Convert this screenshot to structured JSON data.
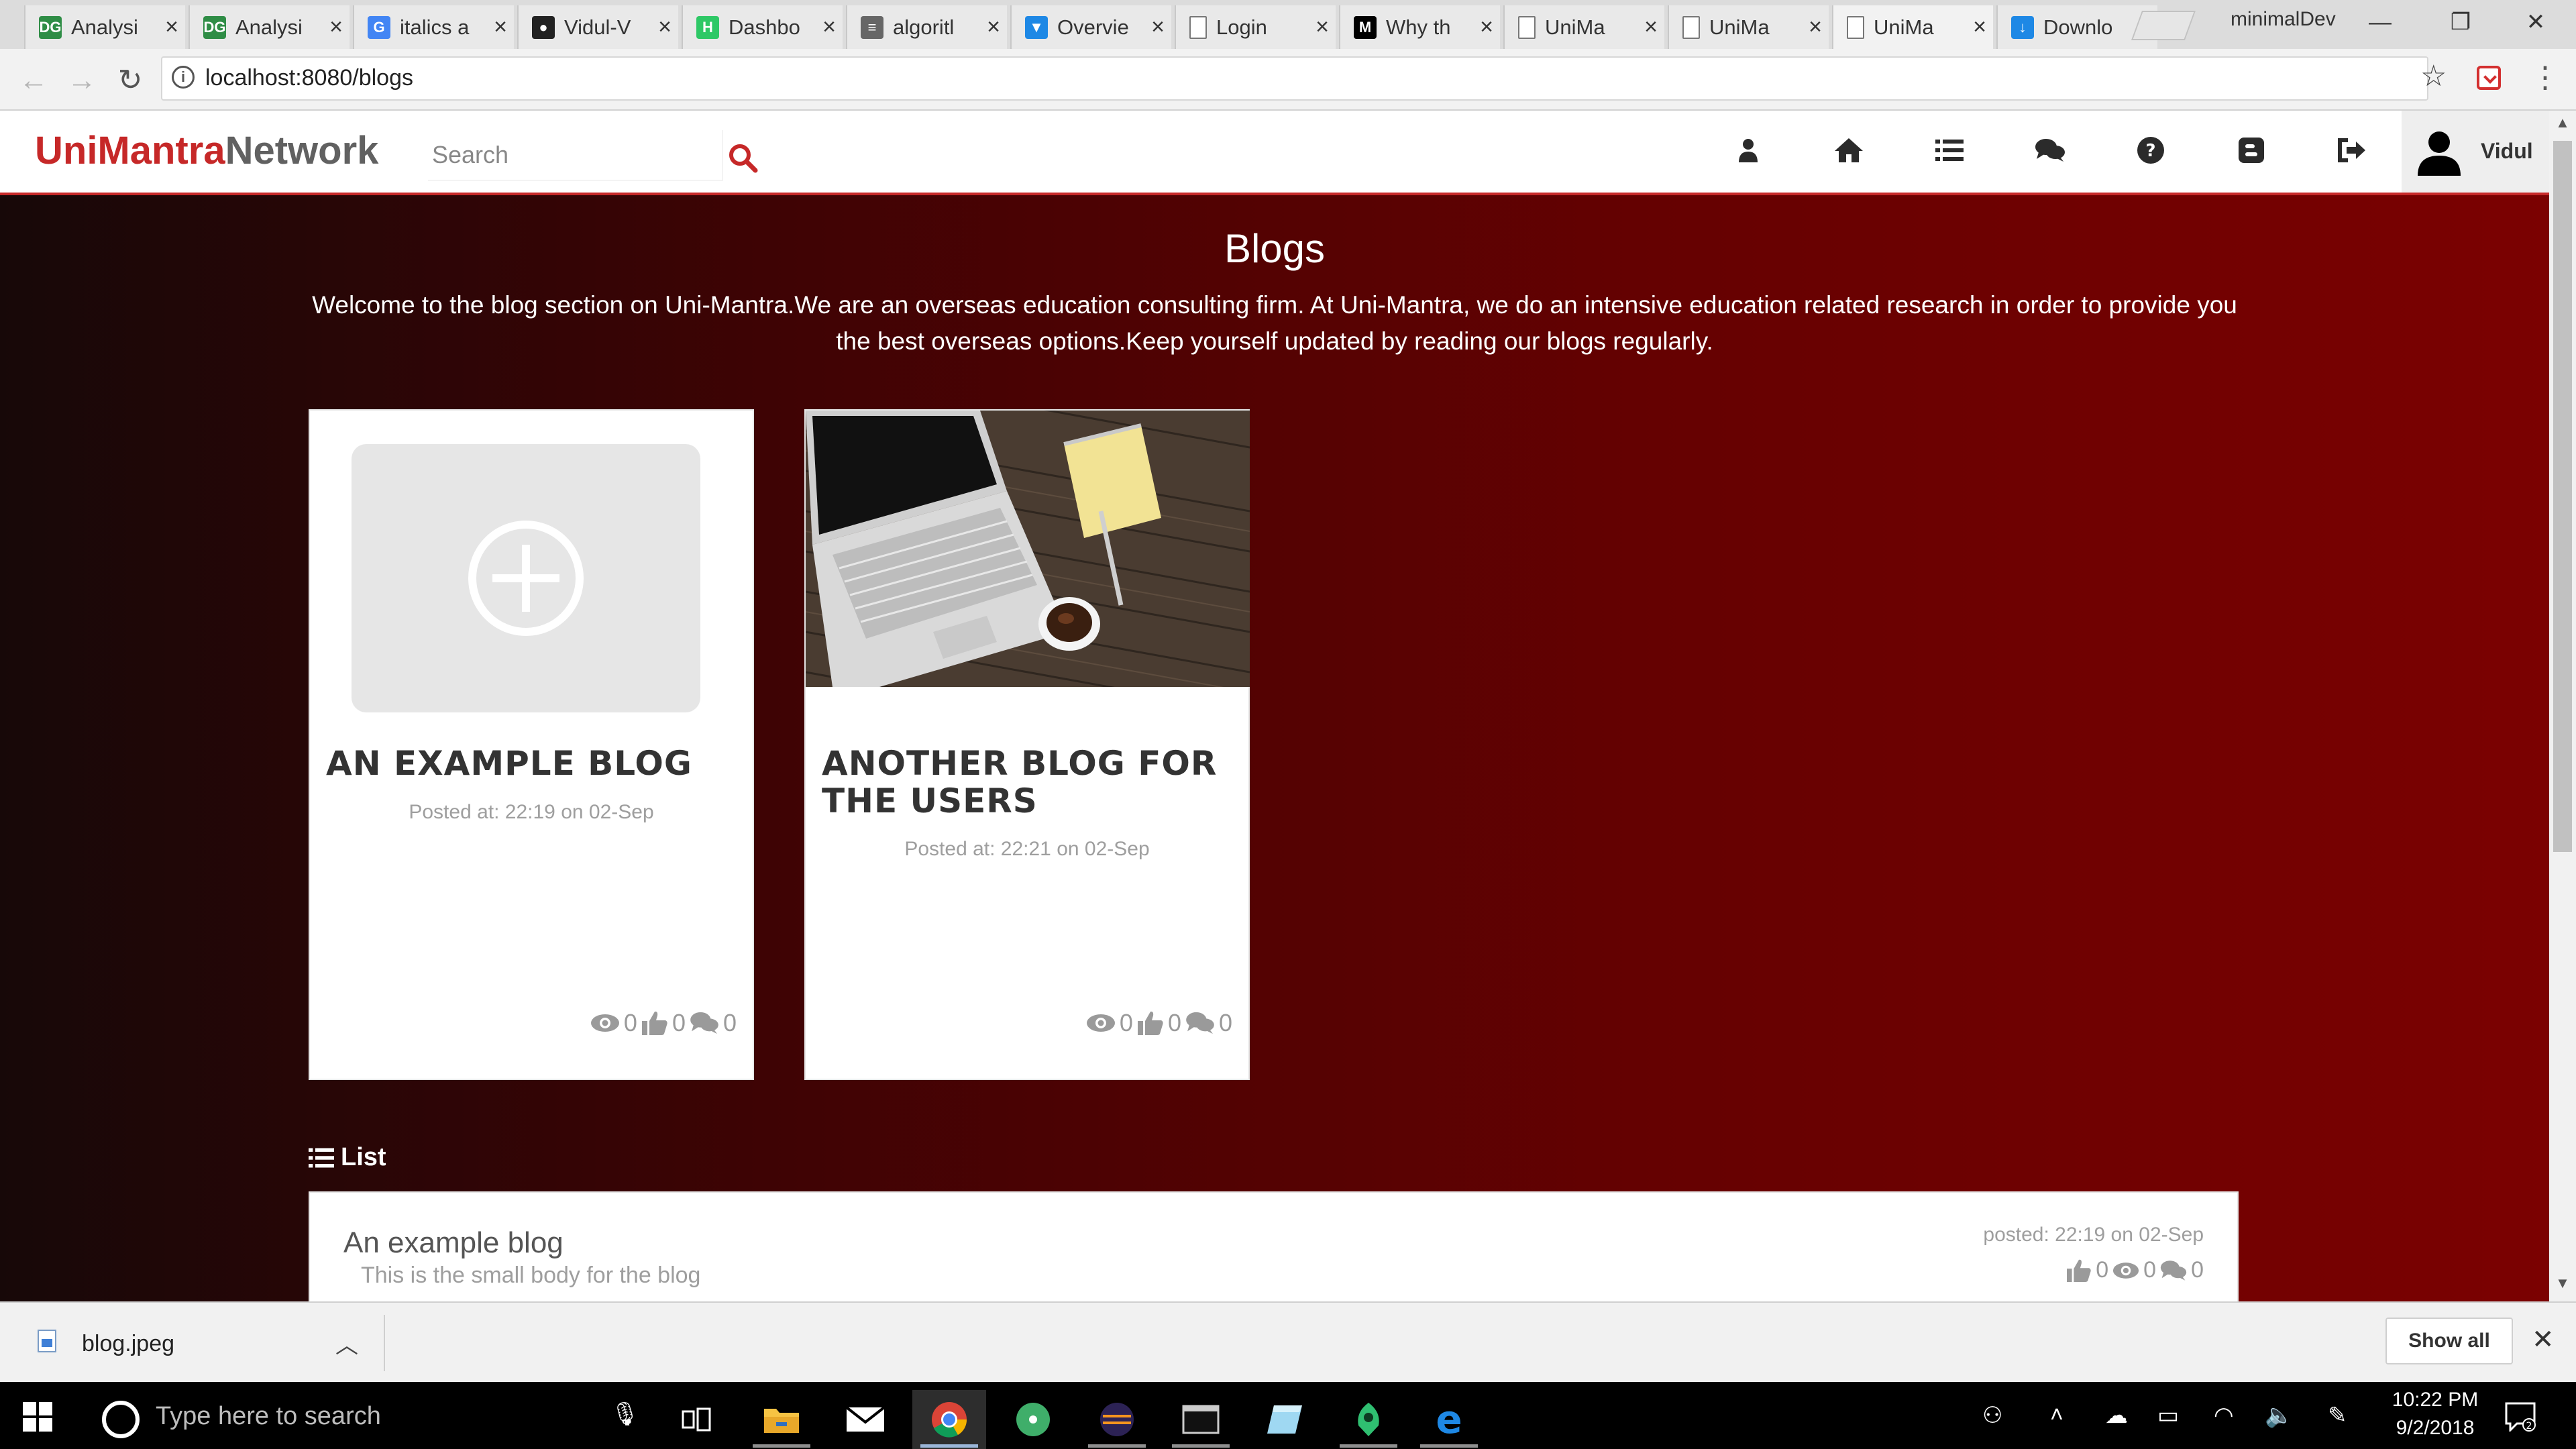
{
  "browser": {
    "tabs": [
      {
        "title": "Analysi",
        "favicon": "gfg-icon",
        "color": "#2f8d46",
        "glyph": "DG"
      },
      {
        "title": "Analysi",
        "favicon": "gfg-icon",
        "color": "#2f8d46",
        "glyph": "DG"
      },
      {
        "title": "italics a",
        "favicon": "google-icon",
        "color": "#4285f4",
        "glyph": "G"
      },
      {
        "title": "Vidul-V",
        "favicon": "github-icon",
        "color": "#222222",
        "glyph": "●"
      },
      {
        "title": "Dashbo",
        "favicon": "hackerearth-icon",
        "color": "#2ec866",
        "glyph": "H"
      },
      {
        "title": "algoritl",
        "favicon": "stackexchange-icon",
        "color": "#666666",
        "glyph": "≡"
      },
      {
        "title": "Overvie",
        "favicon": "shield-icon",
        "color": "#1e88e5",
        "glyph": "▼"
      },
      {
        "title": "Login",
        "favicon": "page-icon",
        "color": "#ffffff",
        "glyph": ""
      },
      {
        "title": "Why th",
        "favicon": "medium-icon",
        "color": "#000000",
        "glyph": "M"
      },
      {
        "title": "UniMa",
        "favicon": "page-icon",
        "color": "#ffffff",
        "glyph": ""
      },
      {
        "title": "UniMa",
        "favicon": "page-icon",
        "color": "#ffffff",
        "glyph": ""
      },
      {
        "title": "UniMa",
        "favicon": "page-icon",
        "color": "#ffffff",
        "glyph": "",
        "active": true
      },
      {
        "title": "Downlo",
        "favicon": "download-icon",
        "color": "#1e88e5",
        "glyph": "↓"
      }
    ],
    "profile": "minimalDev",
    "url": "localhost:8080/blogs"
  },
  "site": {
    "brand_part1": "UniMantra",
    "brand_part2": "Network",
    "search_placeholder": "Search",
    "user_name": "Vidul",
    "accent": "#c62828"
  },
  "page": {
    "title": "Blogs",
    "intro": "Welcome to the blog section on Uni-Mantra.We are an overseas education consulting firm. At Uni-Mantra, we do an intensive education related research in order to provide you the best overseas options.Keep yourself updated by reading our blogs regularly."
  },
  "cards": [
    {
      "title": "AN EXAMPLE BLOG",
      "date": "Posted at: 22:19 on 02-Sep",
      "views": "0",
      "likes": "0",
      "comments": "0"
    },
    {
      "title": "ANOTHER BLOG FOR THE USERS",
      "date": "Posted at: 22:21 on 02-Sep",
      "views": "0",
      "likes": "0",
      "comments": "0"
    }
  ],
  "list": {
    "heading": "List",
    "items": [
      {
        "title": "An example blog",
        "body": "This is the small body for the blog",
        "date": "posted: 22:19 on 02-Sep",
        "likes": "0",
        "views": "0",
        "comments": "0"
      }
    ]
  },
  "download": {
    "filename": "blog.jpeg",
    "show_all": "Show all"
  },
  "taskbar": {
    "search_placeholder": "Type here to search",
    "time": "10:22 PM",
    "date": "9/2/2018",
    "notifications": "2"
  }
}
